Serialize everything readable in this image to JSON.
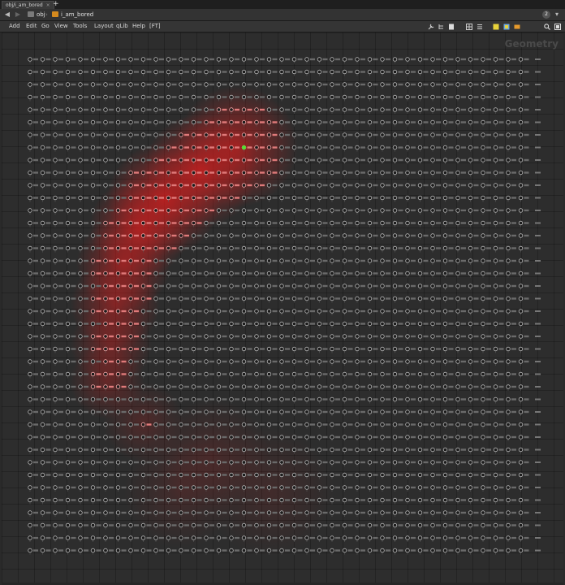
{
  "tab": {
    "label": "obj/i_am_bored",
    "close_glyph": "×",
    "add_glyph": "+"
  },
  "pathbar": {
    "back_glyph": "◀",
    "forward_glyph": "▶",
    "crumbs": [
      {
        "label": "obj",
        "icon": "obj-network-icon"
      },
      {
        "label": "i_am_bored",
        "icon": "geo-node-icon"
      }
    ],
    "separator": "›",
    "badge": "2"
  },
  "menubar": {
    "items": [
      "Add",
      "Edit",
      "Go",
      "View",
      "Tools",
      "Layout",
      "qLib",
      "Help",
      "[FT]"
    ]
  },
  "toolbar_icons": [
    "wrench-icon",
    "tree-icon",
    "page-icon",
    "grid-icon",
    "list-icon",
    "note-icon",
    "color-icon",
    "palette-icon",
    "search-icon",
    "view-icon"
  ],
  "network": {
    "context_label": "Geometry",
    "node_type": "null",
    "columns": 40,
    "rows": 40,
    "background_color": "#2d2d2d",
    "highlight_color": "#ff1a1a",
    "selected_node_color": "#55dd33"
  }
}
